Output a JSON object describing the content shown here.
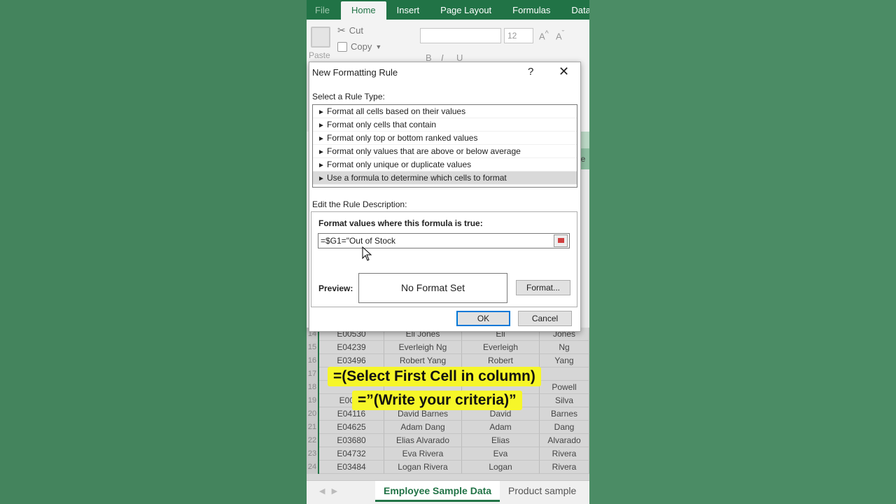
{
  "ribbon": {
    "tabs": [
      "File",
      "Home",
      "Insert",
      "Page Layout",
      "Formulas",
      "Data"
    ],
    "active_tab": "Home",
    "clipboard": {
      "cut": "Cut",
      "copy": "Copy",
      "paste": "Paste"
    },
    "font_size": "12"
  },
  "dialog": {
    "title": "New Formatting Rule",
    "help": "?",
    "close": "✕",
    "select_rule_type_label": "Select a Rule Type:",
    "rule_types": [
      "Format all cells based on their values",
      "Format only cells that contain",
      "Format only top or bottom ranked values",
      "Format only values that are above or below average",
      "Format only unique or duplicate values",
      "Use a formula to determine which cells to format"
    ],
    "selected_rule_index": 5,
    "edit_description_label": "Edit the Rule Description:",
    "formula_label": "Format values where this formula is true:",
    "formula_value": "=$G1=\"Out of Stock",
    "preview_label": "Preview:",
    "preview_text": "No Format Set",
    "format_button": "Format...",
    "ok_button": "OK",
    "cancel_button": "Cancel"
  },
  "sheet": {
    "rows": [
      {
        "num": "14",
        "id": "E00530",
        "full": "Eli Jones",
        "first": "Eli",
        "last": "Jones"
      },
      {
        "num": "15",
        "id": "E04239",
        "full": "Everleigh Ng",
        "first": "Everleigh",
        "last": "Ng"
      },
      {
        "num": "16",
        "id": "E03496",
        "full": "Robert Yang",
        "first": "Robert",
        "last": "Yang"
      },
      {
        "num": "17",
        "id": "",
        "full": "",
        "first": "",
        "last": ""
      },
      {
        "num": "18",
        "id": "",
        "full": "",
        "first": "",
        "last": "Powell"
      },
      {
        "num": "19",
        "id": "E0088",
        "full": "",
        "first": "",
        "last": "Silva"
      },
      {
        "num": "20",
        "id": "E04116",
        "full": "David Barnes",
        "first": "David",
        "last": "Barnes"
      },
      {
        "num": "21",
        "id": "E04625",
        "full": "Adam Dang",
        "first": "Adam",
        "last": "Dang"
      },
      {
        "num": "22",
        "id": "E03680",
        "full": "Elias Alvarado",
        "first": "Elias",
        "last": "Alvarado"
      },
      {
        "num": "23",
        "id": "E04732",
        "full": "Eva Rivera",
        "first": "Eva",
        "last": "Rivera"
      },
      {
        "num": "24",
        "id": "E03484",
        "full": "Logan Rivera",
        "first": "Logan",
        "last": "Rivera"
      }
    ],
    "tabs": [
      "Employee Sample Data",
      "Product sample"
    ],
    "side_header": "e"
  },
  "captions": {
    "line1": "=(Select First Cell in column)",
    "line2": "=”(Write your criteria)”"
  },
  "colors": {
    "excel_green": "#217346",
    "background": "#4a8a63",
    "highlight": "#f6f629"
  }
}
